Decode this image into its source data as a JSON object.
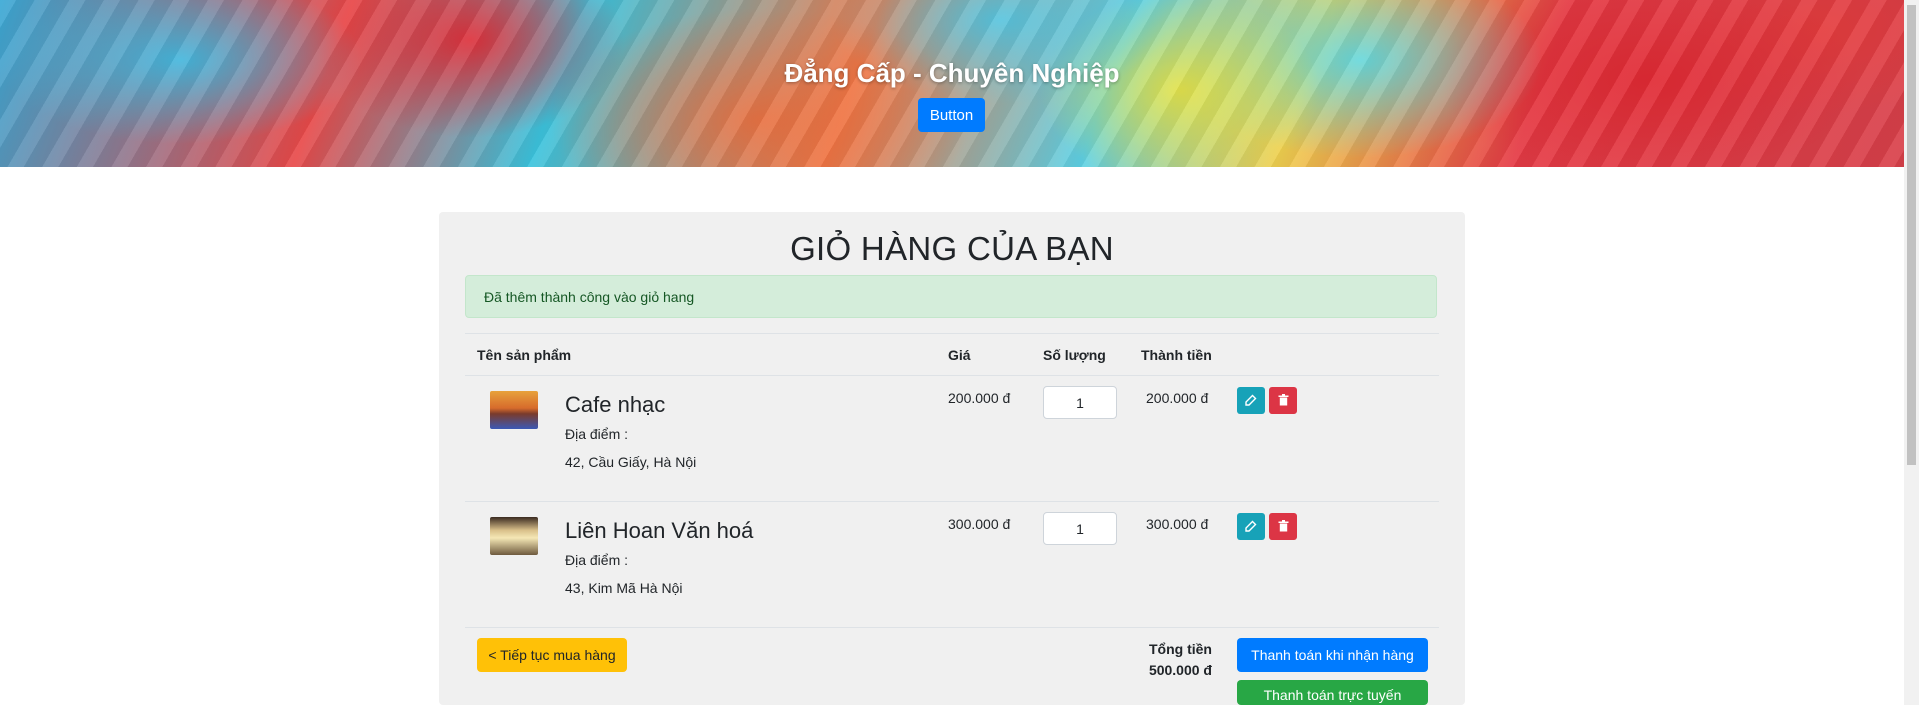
{
  "hero": {
    "title": "Đẳng Cấp - Chuyên Nghiệp",
    "button_label": "Button"
  },
  "cart": {
    "title": "GIỎ HÀNG CỦA BẠN",
    "alert": "Đã thêm thành công vào giỏ hang",
    "headers": {
      "name": "Tên sản phẩm",
      "price": "Giá",
      "quantity": "Số lượng",
      "subtotal": "Thành tiền"
    },
    "items": [
      {
        "name": "Cafe nhạc",
        "location_label": "Địa điểm :",
        "address": "42, Cầu Giấy, Hà Nội",
        "price": "200.000 đ",
        "quantity": "1",
        "subtotal": "200.000 đ",
        "thumbnail": "cafe-music-thumbnail"
      },
      {
        "name": "Liên Hoan Văn hoá",
        "location_label": "Địa điểm :",
        "address": "43, Kim Mã Hà Nội",
        "price": "300.000 đ",
        "quantity": "1",
        "subtotal": "300.000 đ",
        "thumbnail": "culture-festival-thumbnail"
      }
    ],
    "continue_label": "< Tiếp tục mua hàng",
    "total_label": "Tổng tiền",
    "total_value": "500.000 đ",
    "pay_on_delivery_label": "Thanh toán khi nhận hàng",
    "pay_online_label": "Thanh toán trực tuyến"
  },
  "colors": {
    "primary": "#007bff",
    "success": "#28a745",
    "warning": "#ffc107",
    "danger": "#dc3545",
    "info": "#17a2b8",
    "alert_bg": "#d4edda"
  },
  "icons": {
    "edit": "edit-icon",
    "delete": "trash-icon"
  }
}
